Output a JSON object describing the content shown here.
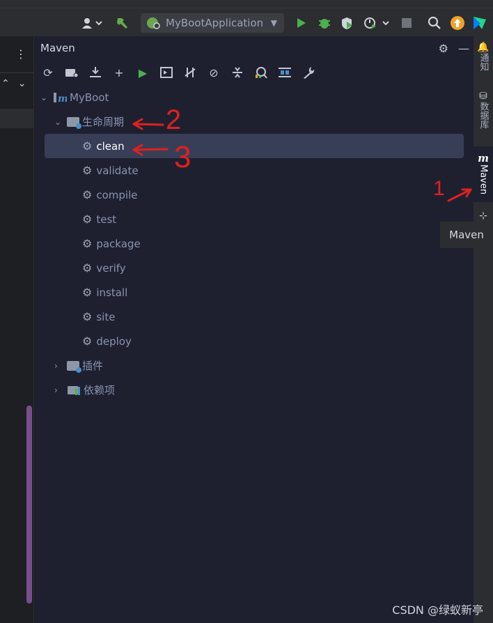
{
  "toolbar": {
    "run_config": "MyBootApplication"
  },
  "maven": {
    "title": "Maven",
    "tree": {
      "root": "MyBoot",
      "lifecycle": "生命周期",
      "goals": [
        "clean",
        "validate",
        "compile",
        "test",
        "package",
        "verify",
        "install",
        "site",
        "deploy"
      ],
      "plugins": "插件",
      "dependencies": "依赖项"
    }
  },
  "right_sidebar": {
    "notifications": "通知",
    "database": "数据库",
    "maven": "Maven"
  },
  "tooltip": "Maven",
  "annotations": [
    "2",
    "3",
    "1"
  ],
  "watermark": "CSDN @绿蚁新亭",
  "colors": {
    "accent_annotation": "#e0211e",
    "selected_row": "#393e57",
    "run_green": "#4caf50"
  }
}
